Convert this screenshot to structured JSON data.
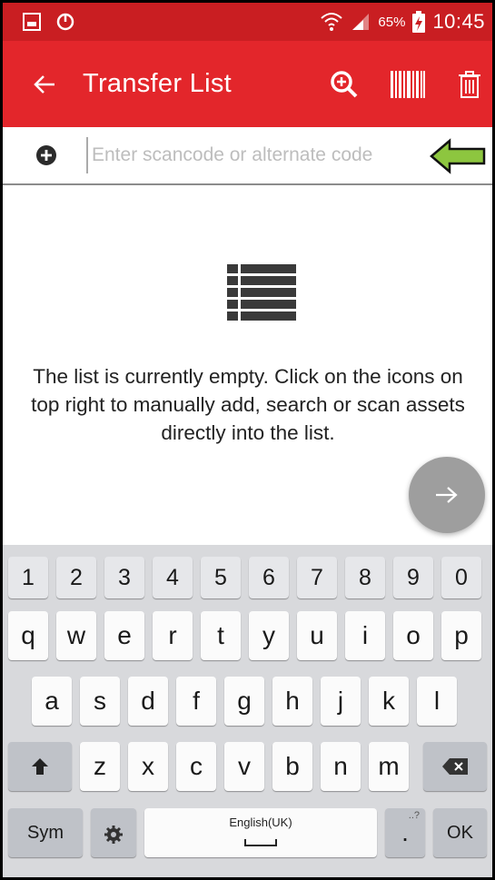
{
  "status_bar": {
    "battery_percent": "65%",
    "clock": "10:45",
    "icons": [
      "image-notification-icon",
      "sync-icon",
      "wifi-icon",
      "signal-icon",
      "battery-charging-icon"
    ]
  },
  "app_bar": {
    "title": "Transfer List",
    "back_icon": "arrow-left-icon",
    "actions": [
      "search-add-icon",
      "barcode-scan-icon",
      "trash-icon"
    ]
  },
  "scan_input": {
    "value": "",
    "placeholder": "Enter scancode or alternate code",
    "add_icon": "plus-circle-icon",
    "indicator_icon": "green-arrow-left-icon"
  },
  "empty_state": {
    "icon": "list-icon",
    "message": "The list is currently empty. Click on the icons on top right to manually add, search or scan assets directly into the list."
  },
  "fab": {
    "icon": "arrow-right-icon"
  },
  "keyboard": {
    "number_row": [
      "1",
      "2",
      "3",
      "4",
      "5",
      "6",
      "7",
      "8",
      "9",
      "0"
    ],
    "row1": [
      "q",
      "w",
      "e",
      "r",
      "t",
      "y",
      "u",
      "i",
      "o",
      "p"
    ],
    "row2": [
      "a",
      "s",
      "d",
      "f",
      "g",
      "h",
      "j",
      "k",
      "l"
    ],
    "row3": [
      "z",
      "x",
      "c",
      "v",
      "b",
      "n",
      "m"
    ],
    "sym_label": "Sym",
    "space_label": "English(UK)",
    "period_label": ".",
    "period_sup": "..?",
    "ok_label": "OK",
    "colors": {
      "key": "#fbfbfb",
      "func_key": "#bfc2c8",
      "background": "#d8d9dc"
    }
  },
  "colors": {
    "status_bar": "#c91e22",
    "app_bar": "#e3262b",
    "fab": "#9e9e9e",
    "indicator_arrow": "#8dc63f"
  }
}
